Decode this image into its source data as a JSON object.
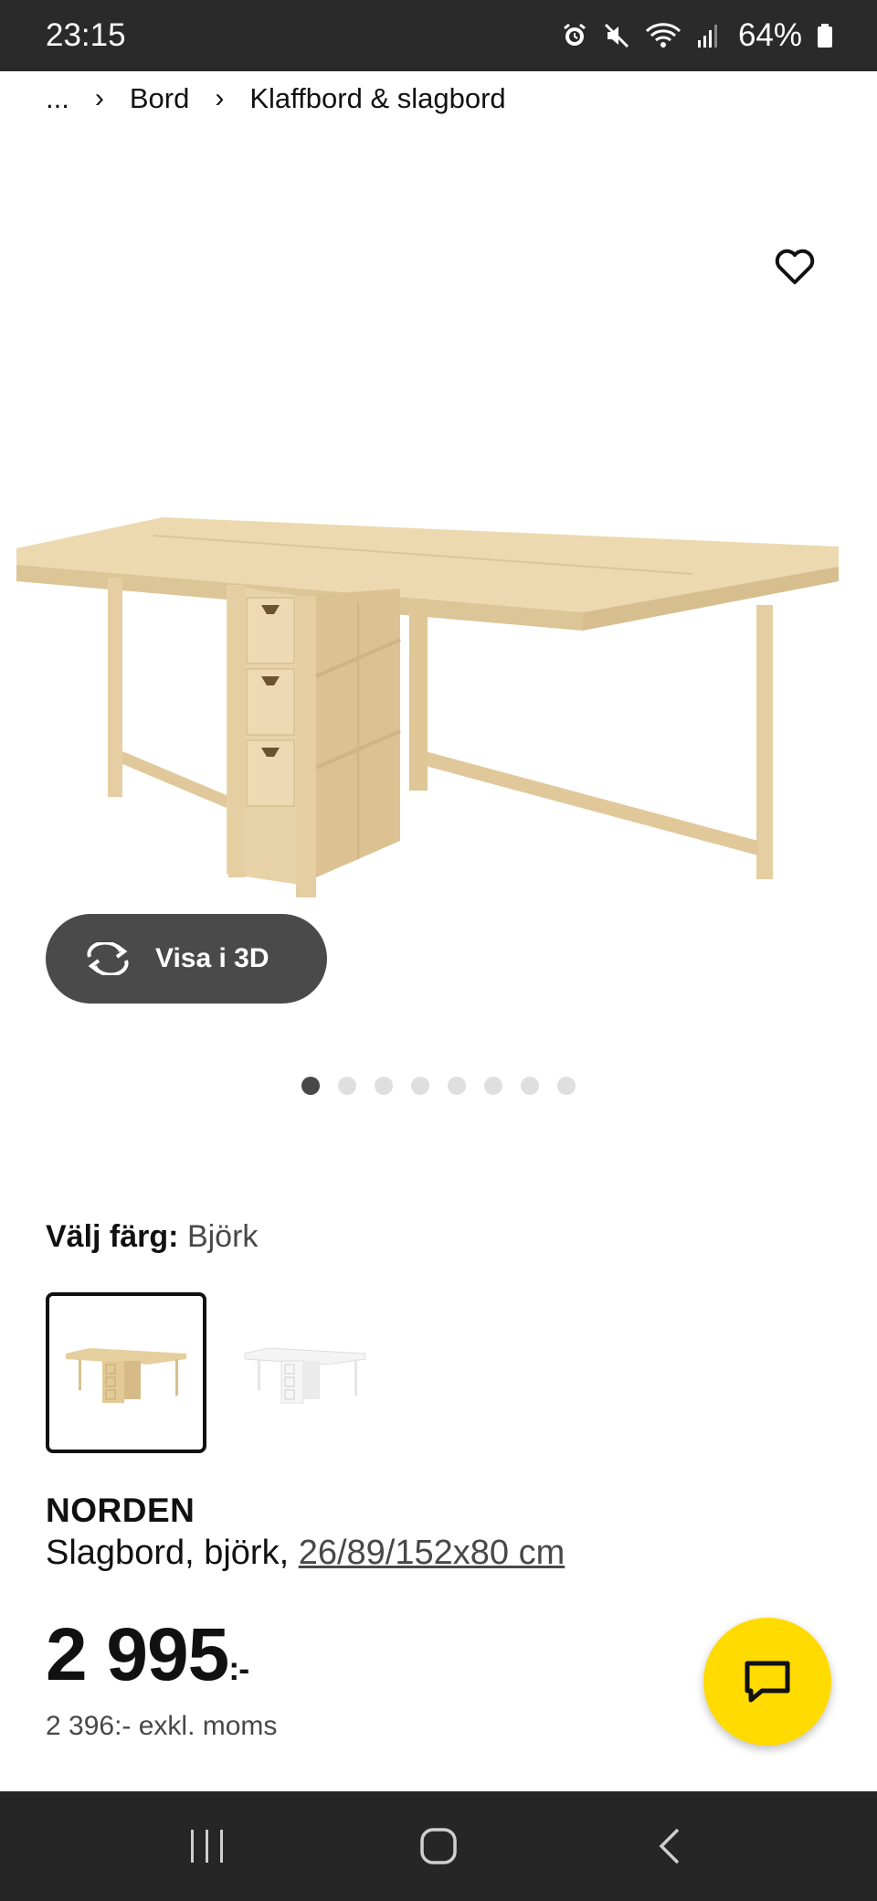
{
  "status_bar": {
    "time": "23:15",
    "battery_percent": "64%",
    "icons": [
      "alarm-icon",
      "mute-icon",
      "wifi-icon",
      "signal-icon",
      "battery-icon"
    ]
  },
  "breadcrumb": {
    "ellipsis": "...",
    "items": [
      "Bord",
      "Klaffbord & slagbord"
    ]
  },
  "gallery": {
    "view3d_label": "Visa i 3D",
    "page_count": 8,
    "active_page": 1
  },
  "color": {
    "label": "Välj färg:",
    "value": "Björk",
    "options": [
      "björk",
      "vit"
    ]
  },
  "product": {
    "name": "NORDEN",
    "desc_prefix": "Slagbord, björk,",
    "size": "26/89/152x80 cm"
  },
  "price": {
    "amount": "2 995",
    "suffix": ":-",
    "excl_vat": "2 396:- exkl. moms"
  },
  "colors": {
    "accent_yellow": "#ffdb00",
    "button_dark": "#4a4a4a",
    "birch": "#ecd9b0"
  }
}
